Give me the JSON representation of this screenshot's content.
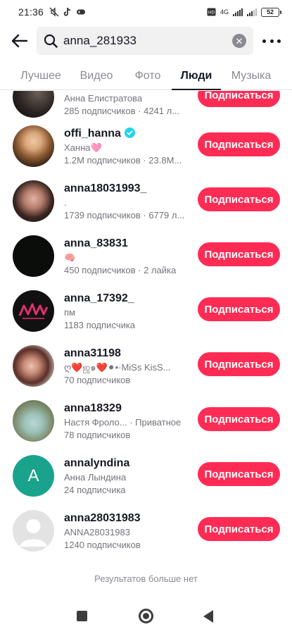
{
  "status_bar": {
    "time": "21:36",
    "network": "4G",
    "battery": "52"
  },
  "search": {
    "query": "anna_281933",
    "icons": [
      "back-arrow-icon",
      "search-icon",
      "clear-icon",
      "more-icon"
    ]
  },
  "tabs": [
    {
      "label": "Лучшее",
      "active": false
    },
    {
      "label": "Видео",
      "active": false
    },
    {
      "label": "Фото",
      "active": false
    },
    {
      "label": "Люди",
      "active": true
    },
    {
      "label": "Музыка",
      "active": false
    }
  ],
  "users": [
    {
      "username": "",
      "nickname": "Анна Елистратова",
      "stats": "285 подписчиков · 4241 л...",
      "button": "Подписаться",
      "verified": false
    },
    {
      "username": "offi_hanna",
      "nickname": "Ханна🩷",
      "stats": "1.2M подписчиков · 23.8M...",
      "button": "Подписаться",
      "verified": true
    },
    {
      "username": "anna18031993_",
      "nickname": ".",
      "stats": "1739 подписчиков · 6779 л...",
      "button": "Подписаться",
      "verified": false
    },
    {
      "username": "anna_83831",
      "nickname": "🧠",
      "stats": "450 подписчиков · 2 лайка",
      "button": "Подписаться",
      "verified": false
    },
    {
      "username": "anna_17392_",
      "nickname": "пм",
      "stats": "1183 подписчика",
      "button": "Подписаться",
      "verified": false
    },
    {
      "username": "anna31198",
      "nickname": "ღ❤️ஜ๑❤️⚫•·MiSs KisS...",
      "stats": "70 подписчиков",
      "button": "Подписаться",
      "verified": false
    },
    {
      "username": "anna18329",
      "nickname": "Настя Фроло... · Приватное",
      "stats": "78 подписчиков",
      "button": "Подписаться",
      "verified": false
    },
    {
      "username": "annalyndina",
      "nickname": "Анна Лындина",
      "stats": "24 подписчика",
      "button": "Подписаться",
      "verified": false,
      "avatar_letter": "A"
    },
    {
      "username": "anna28031983",
      "nickname": "ANNA28031983",
      "stats": "1240 подписчиков",
      "button": "Подписаться",
      "verified": false
    }
  ],
  "end_of_results": "Результатов больше нет",
  "colors": {
    "accent": "#fe2c55",
    "verified": "#20d5ec",
    "letter_avatar": "#1aa38c"
  }
}
